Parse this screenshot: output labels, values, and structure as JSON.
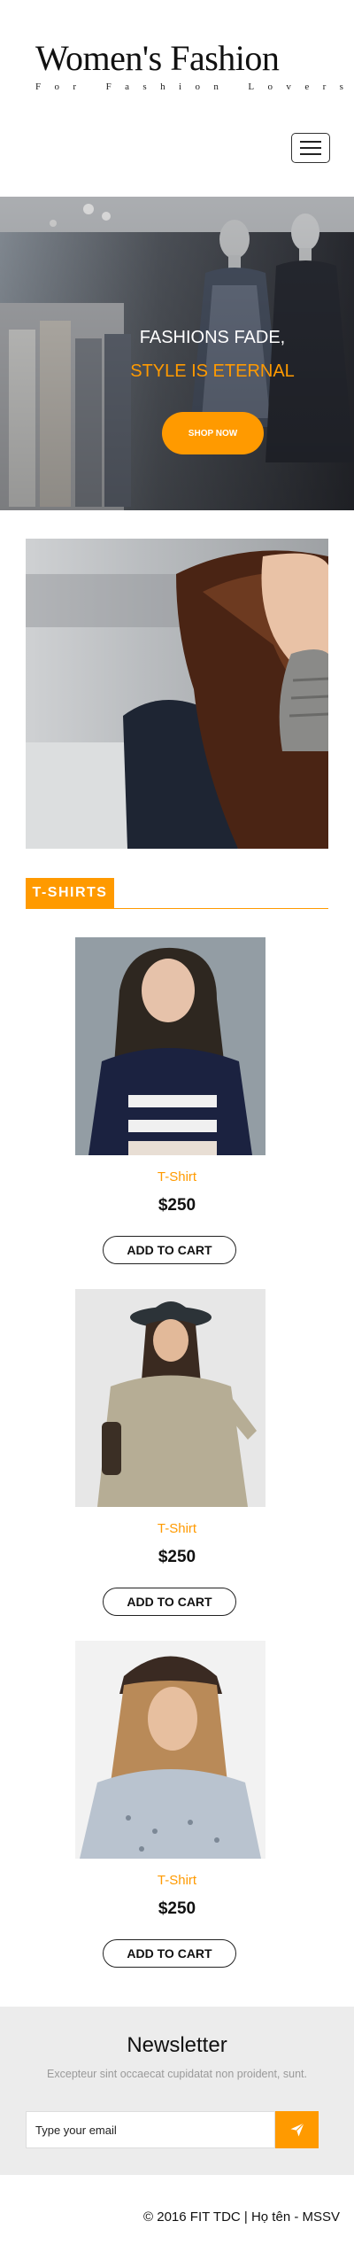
{
  "brand": {
    "title": "Women's Fashion",
    "tagline": "For Fashion Lovers"
  },
  "hero": {
    "line1": "FASHIONS FADE,",
    "line2": "STYLE IS ETERNAL",
    "cta": "SHOP NOW"
  },
  "section": {
    "title": "T-SHIRTS"
  },
  "products": [
    {
      "name": "T-Shirt",
      "price": "$250",
      "cta": "ADD TO CART"
    },
    {
      "name": "T-Shirt",
      "price": "$250",
      "cta": "ADD TO CART"
    },
    {
      "name": "T-Shirt",
      "price": "$250",
      "cta": "ADD TO CART"
    }
  ],
  "newsletter": {
    "title": "Newsletter",
    "subtitle": "Excepteur sint occaecat cupidatat non proident, sunt.",
    "placeholder": "Type your email"
  },
  "footer": {
    "copyright": "© 2016 FIT TDC | Họ tên - MSSV"
  },
  "colors": {
    "accent": "#ff9a00",
    "newsletter_bg": "#ececec"
  }
}
